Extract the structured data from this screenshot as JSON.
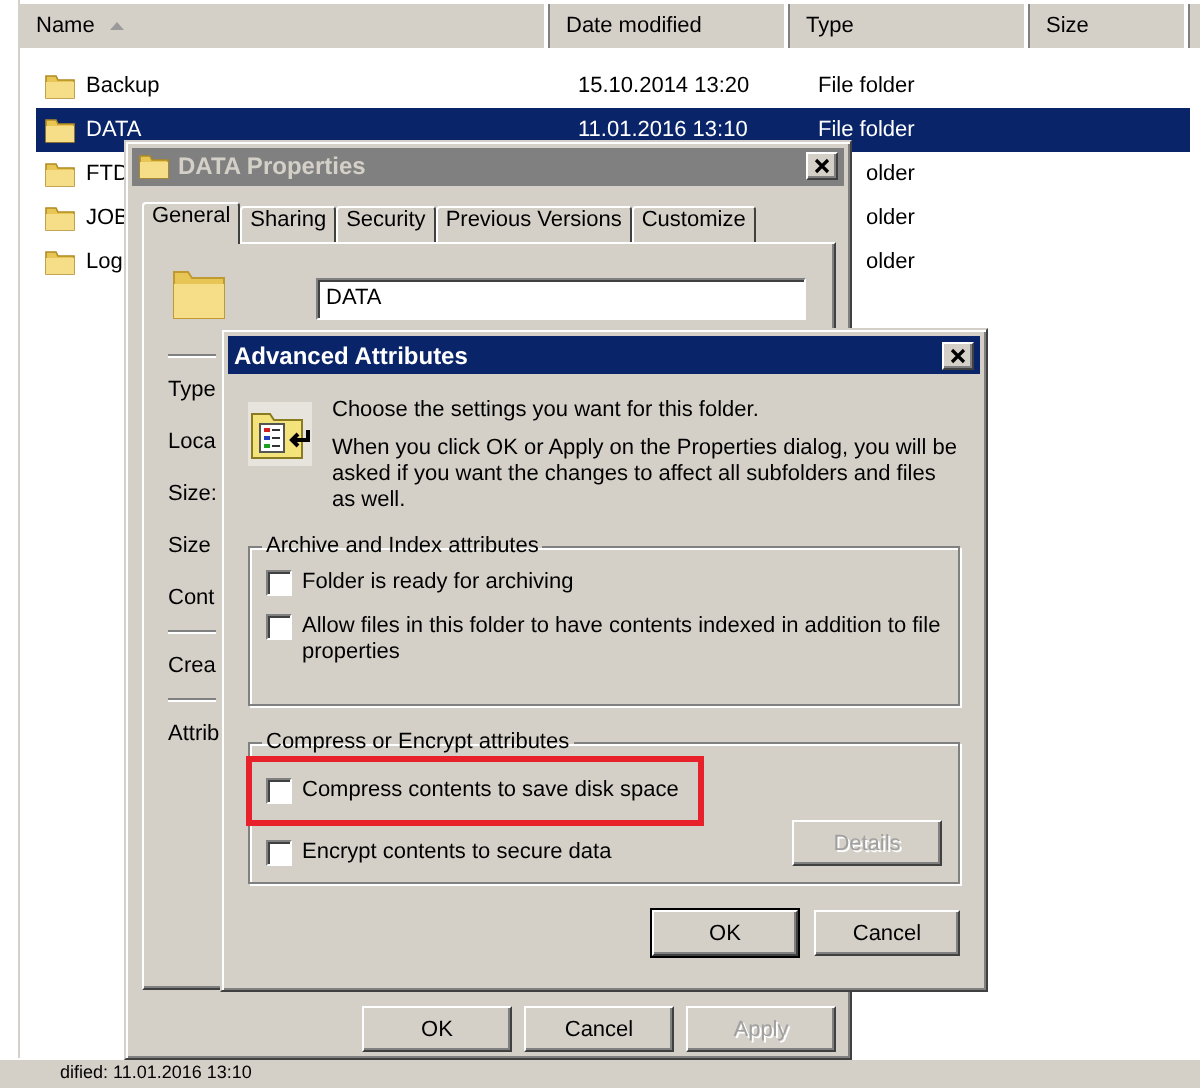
{
  "explorer": {
    "columns": [
      {
        "label": "Name",
        "sorted": true
      },
      {
        "label": "Date modified"
      },
      {
        "label": "Type"
      },
      {
        "label": "Size"
      }
    ],
    "rows": [
      {
        "kind": "full",
        "name": "Backup",
        "date_modified": "15.10.2014 13:20",
        "type": "File folder",
        "selected": false
      },
      {
        "kind": "full",
        "name": "DATA",
        "date_modified": "11.01.2016 13:10",
        "type": "File folder",
        "selected": true
      },
      {
        "kind": "covered",
        "name": "FTD",
        "type": "older",
        "selected": false
      },
      {
        "kind": "covered",
        "name": "JOB",
        "type": "older",
        "selected": false
      },
      {
        "kind": "covered",
        "name": "Log",
        "type": "older",
        "selected": false
      }
    ],
    "status_bar": "dified: 11.01.2016 13:10"
  },
  "properties_dialog": {
    "title": "DATA Properties",
    "active": false,
    "tabs": [
      {
        "label": "General",
        "selected": true
      },
      {
        "label": "Sharing",
        "selected": false
      },
      {
        "label": "Security",
        "selected": false
      },
      {
        "label": "Previous Versions",
        "selected": false
      },
      {
        "label": "Customize",
        "selected": false
      }
    ],
    "name_field": {
      "value": "DATA"
    },
    "labels": [
      "Type",
      "Loca",
      "Size:",
      "Size",
      "Cont",
      "Crea",
      "Attrib"
    ],
    "buttons": [
      {
        "label": "OK",
        "disabled": false
      },
      {
        "label": "Cancel",
        "disabled": false
      },
      {
        "label": "Apply",
        "disabled": true
      }
    ]
  },
  "advanced_dialog": {
    "title": "Advanced Attributes",
    "active": true,
    "intro": "Choose the settings you want for this folder.",
    "note": "When you click OK or Apply on the Properties dialog, you will be asked if you want the changes to affect all subfolders and files as well.",
    "groups": [
      {
        "title": "Archive and Index attributes",
        "options": [
          {
            "label": "Folder is ready for archiving",
            "checked": false,
            "highlighted": false
          },
          {
            "label": "Allow files in this folder to have contents indexed in addition to file properties",
            "checked": false,
            "highlighted": false
          }
        ]
      },
      {
        "title": "Compress or Encrypt attributes",
        "options": [
          {
            "label": "Compress contents to save disk space",
            "checked": false,
            "highlighted": true
          },
          {
            "label": "Encrypt contents to secure data",
            "checked": false,
            "highlighted": false
          }
        ],
        "details_button": {
          "label": "Details",
          "disabled": true
        }
      }
    ],
    "buttons": [
      {
        "label": "OK",
        "disabled": false,
        "default": true
      },
      {
        "label": "Cancel",
        "disabled": false,
        "default": false
      }
    ]
  }
}
